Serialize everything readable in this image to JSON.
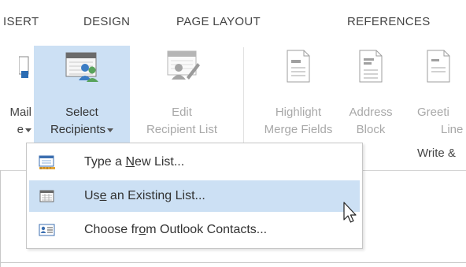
{
  "tabs": [
    {
      "label": "ISERT"
    },
    {
      "label": "DESIGN"
    },
    {
      "label": "PAGE LAYOUT"
    },
    {
      "label": "REFERENCES"
    }
  ],
  "ribbon": {
    "mail": {
      "line1": "Mail",
      "line2": "e"
    },
    "select_recipients": {
      "line1": "Select",
      "line2": "Recipients"
    },
    "edit_recipient_list": {
      "line1": "Edit",
      "line2": "Recipient List"
    },
    "highlight_merge_fields": {
      "line1": "Highlight",
      "line2": "Merge Fields"
    },
    "address_block": {
      "line1": "Address",
      "line2": "Block"
    },
    "greeting_line": {
      "line1": "Greeti",
      "line2": "Line"
    },
    "group_label": "Write &"
  },
  "menu": {
    "items": [
      {
        "pre": "Type a ",
        "accel": "N",
        "post": "ew List...",
        "icon": "new-list-icon"
      },
      {
        "pre": "Us",
        "accel": "e",
        "post": " an Existing List...",
        "icon": "existing-list-icon"
      },
      {
        "pre": "Choose fr",
        "accel": "o",
        "post": "m Outlook Contacts...",
        "icon": "contacts-card-icon"
      }
    ]
  },
  "colors": {
    "highlight": "#cce0f4",
    "disabled_text": "#a8a8a8",
    "text": "#444444"
  }
}
